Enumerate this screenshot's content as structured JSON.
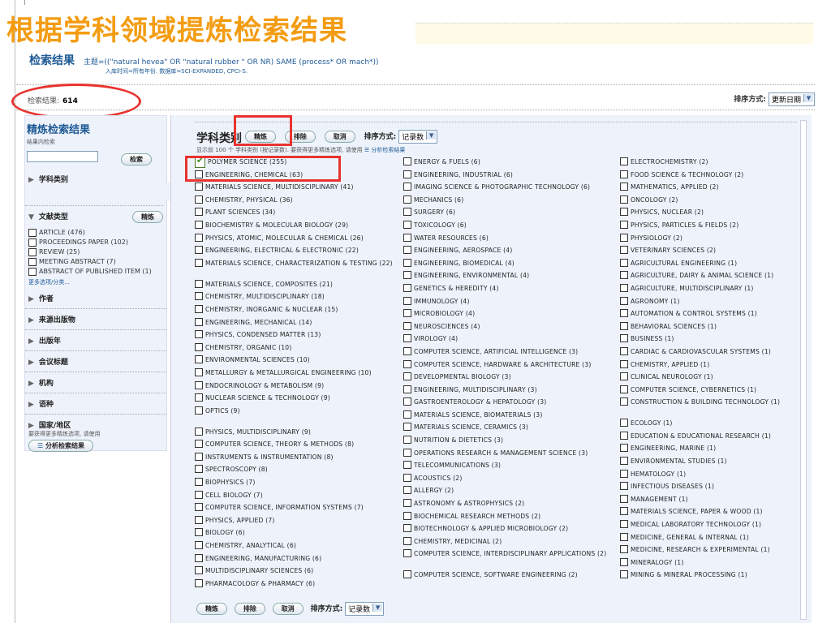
{
  "slide": {
    "title": "根据学科领域提炼检索结果"
  },
  "results": {
    "heading": "检索结果",
    "query": "主题=((\"natural hevea\" OR \"natural rubber \" OR NR) SAME (process* OR mach*))",
    "sub": "入库时间=所有年份. 数据库=SCI-EXPANDED, CPCI-S.",
    "count_label": "检索结果:",
    "count": "614",
    "sort_label": "排序方式:",
    "sort_value": "更新日期"
  },
  "sidebar": {
    "title": "精炼检索结果",
    "search_within": "结果内检索",
    "search_button": "检索",
    "subject_section": "学科类别",
    "doctype_section": "文献类型",
    "refine_button": "精炼",
    "doctypes": [
      "ARTICLE (476)",
      "PROCEEDINGS PAPER (102)",
      "REVIEW (25)",
      "MEETING ABSTRACT (7)",
      "ABSTRACT OF PUBLISHED ITEM (1)"
    ],
    "more": "更多选项/分类...",
    "sections": [
      "作者",
      "来源出版物",
      "出版年",
      "会议标题",
      "机构",
      "语种",
      "国家/地区"
    ],
    "analyze_hint": "要获得更多精炼选项, 请使用",
    "analyze_button": "分析检索结果"
  },
  "main": {
    "heading": "学科类别",
    "refine": "精炼",
    "exclude": "排除",
    "cancel": "取消",
    "sort_label": "排序方式:",
    "sort_value": "记录数",
    "info_prefix": "显示前 100 个 学科类别 (按记录数). 要获得更多精炼选项, 请使用",
    "info_link": "分析检索结果",
    "columns": [
      [
        "POLYMER SCIENCE (255)",
        "ENGINEERING, CHEMICAL (63)",
        "MATERIALS SCIENCE, MULTIDISCIPLINARY (41)",
        "CHEMISTRY, PHYSICAL (36)",
        "PLANT SCIENCES (34)",
        "BIOCHEMISTRY & MOLECULAR BIOLOGY (29)",
        "PHYSICS, ATOMIC, MOLECULAR & CHEMICAL (26)",
        "ENGINEERING, ELECTRICAL & ELECTRONIC (22)",
        "MATERIALS SCIENCE, CHARACTERIZATION & TESTING (22)",
        "MATERIALS SCIENCE, COMPOSITES (21)",
        "CHEMISTRY, MULTIDISCIPLINARY (18)",
        "CHEMISTRY, INORGANIC & NUCLEAR (15)",
        "ENGINEERING, MECHANICAL (14)",
        "PHYSICS, CONDENSED MATTER (13)",
        "CHEMISTRY, ORGANIC (10)",
        "ENVIRONMENTAL SCIENCES (10)",
        "METALLURGY & METALLURGICAL ENGINEERING (10)",
        "ENDOCRINOLOGY & METABOLISM (9)",
        "NUCLEAR SCIENCE & TECHNOLOGY (9)",
        "OPTICS (9)",
        "PHYSICS, MULTIDISCIPLINARY (9)",
        "COMPUTER SCIENCE, THEORY & METHODS (8)",
        "INSTRUMENTS & INSTRUMENTATION (8)",
        "SPECTROSCOPY (8)",
        "BIOPHYSICS (7)",
        "CELL BIOLOGY (7)",
        "COMPUTER SCIENCE, INFORMATION SYSTEMS (7)",
        "PHYSICS, APPLIED (7)",
        "BIOLOGY (6)",
        "CHEMISTRY, ANALYTICAL (6)",
        "ENGINEERING, MANUFACTURING (6)",
        "MULTIDISCIPLINARY SCIENCES (6)",
        "PHARMACOLOGY & PHARMACY (6)"
      ],
      [
        "ENERGY & FUELS (6)",
        "ENGINEERING, INDUSTRIAL (6)",
        "IMAGING SCIENCE & PHOTOGRAPHIC TECHNOLOGY (6)",
        "MECHANICS (6)",
        "SURGERY (6)",
        "TOXICOLOGY (6)",
        "WATER RESOURCES (6)",
        "ENGINEERING, AEROSPACE (4)",
        "ENGINEERING, BIOMEDICAL (4)",
        "ENGINEERING, ENVIRONMENTAL (4)",
        "GENETICS & HEREDITY (4)",
        "IMMUNOLOGY (4)",
        "MICROBIOLOGY (4)",
        "NEUROSCIENCES (4)",
        "VIROLOGY (4)",
        "COMPUTER SCIENCE, ARTIFICIAL INTELLIGENCE (3)",
        "COMPUTER SCIENCE, HARDWARE & ARCHITECTURE (3)",
        "DEVELOPMENTAL BIOLOGY (3)",
        "ENGINEERING, MULTIDISCIPLINARY (3)",
        "GASTROENTEROLOGY & HEPATOLOGY (3)",
        "MATERIALS SCIENCE, BIOMATERIALS (3)",
        "MATERIALS SCIENCE, CERAMICS (3)",
        "NUTRITION & DIETETICS (3)",
        "OPERATIONS RESEARCH & MANAGEMENT SCIENCE (3)",
        "TELECOMMUNICATIONS (3)",
        "ACOUSTICS (2)",
        "ALLERGY (2)",
        "ASTRONOMY & ASTROPHYSICS (2)",
        "BIOCHEMICAL RESEARCH METHODS (2)",
        "BIOTECHNOLOGY & APPLIED MICROBIOLOGY (2)",
        "CHEMISTRY, MEDICINAL (2)",
        "COMPUTER SCIENCE, INTERDISCIPLINARY APPLICATIONS (2)",
        "COMPUTER SCIENCE, SOFTWARE ENGINEERING (2)"
      ],
      [
        "ELECTROCHEMISTRY (2)",
        "FOOD SCIENCE & TECHNOLOGY (2)",
        "MATHEMATICS, APPLIED (2)",
        "ONCOLOGY (2)",
        "PHYSICS, NUCLEAR (2)",
        "PHYSICS, PARTICLES & FIELDS (2)",
        "PHYSIOLOGY (2)",
        "VETERINARY SCIENCES (2)",
        "AGRICULTURAL ENGINEERING (1)",
        "AGRICULTURE, DAIRY & ANIMAL SCIENCE (1)",
        "AGRICULTURE, MULTIDISCIPLINARY (1)",
        "AGRONOMY (1)",
        "AUTOMATION & CONTROL SYSTEMS (1)",
        "BEHAVIORAL SCIENCES (1)",
        "BUSINESS (1)",
        "CARDIAC & CARDIOVASCULAR SYSTEMS (1)",
        "CHEMISTRY, APPLIED (1)",
        "CLINICAL NEUROLOGY (1)",
        "COMPUTER SCIENCE, CYBERNETICS (1)",
        "CONSTRUCTION & BUILDING TECHNOLOGY (1)",
        "ECOLOGY (1)",
        "EDUCATION & EDUCATIONAL RESEARCH (1)",
        "ENGINEERING, MARINE (1)",
        "ENVIRONMENTAL STUDIES (1)",
        "HEMATOLOGY (1)",
        "INFECTIOUS DISEASES (1)",
        "MANAGEMENT (1)",
        "MATERIALS SCIENCE, PAPER & WOOD (1)",
        "MEDICAL LABORATORY TECHNOLOGY (1)",
        "MEDICINE, GENERAL & INTERNAL (1)",
        "MEDICINE, RESEARCH & EXPERIMENTAL (1)",
        "MINERALOGY (1)",
        "MINING & MINERAL PROCESSING (1)"
      ]
    ]
  }
}
